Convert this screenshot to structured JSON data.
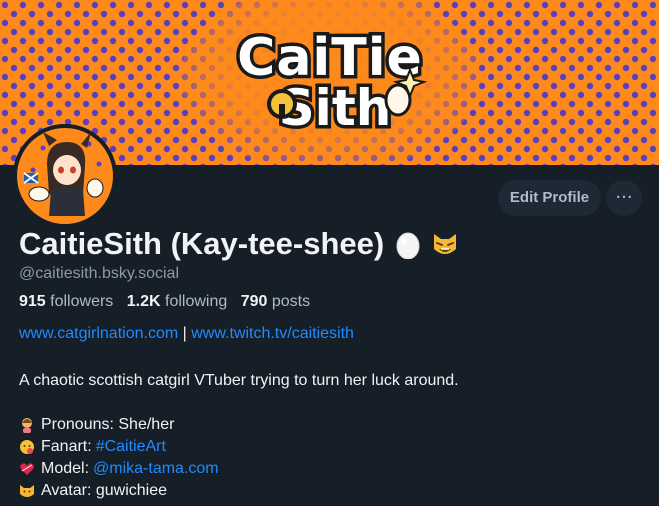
{
  "banner": {
    "logo_line1": "CaiTie",
    "logo_line2": "Sith",
    "bg_color": "#ff8a1c",
    "dot_color": "#5a3fc0"
  },
  "profile": {
    "display_name": "CaitieSith (Kay-tee-shee)",
    "name_emojis": [
      "egg-icon",
      "cat-face-icon"
    ],
    "handle": "@caitiesith.bsky.social",
    "stats": {
      "followers_count": "915",
      "followers_label": "followers",
      "following_count": "1.2K",
      "following_label": "following",
      "posts_count": "790",
      "posts_label": "posts"
    },
    "links": {
      "link1": "www.catgirlnation.com",
      "separator": "|",
      "link2": "www.twitch.tv/caitiesith"
    },
    "bio": {
      "intro": "A chaotic scottish catgirl VTuber trying to turn her luck around.",
      "pronouns_label": "Pronouns: She/her",
      "fanart_label": "Fanart: ",
      "fanart_tag": "#CaitieArt",
      "model_label": "Model: ",
      "model_link": "@mika-tama.com",
      "avatar_label": "Avatar: guwichiee"
    }
  },
  "actions": {
    "edit_profile": "Edit Profile",
    "more": "···"
  },
  "colors": {
    "background": "#161e27",
    "accent_link": "#208bfe",
    "button_bg": "#1e2936"
  }
}
